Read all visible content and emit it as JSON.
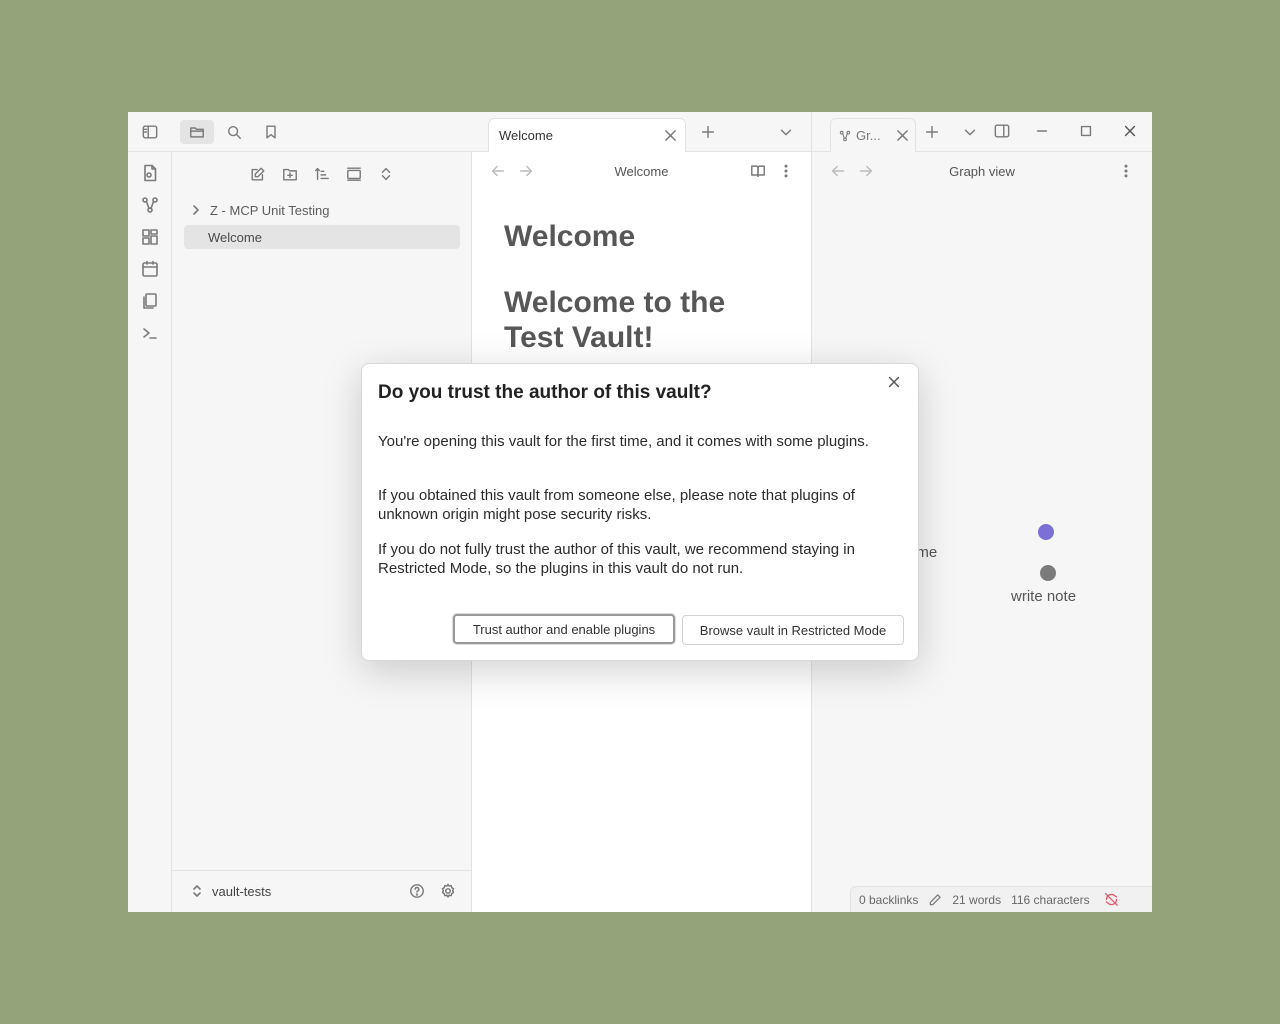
{
  "explorer": {
    "tree": [
      {
        "label": "Z - MCP Unit Testing",
        "type": "folder"
      },
      {
        "label": "Welcome",
        "type": "file",
        "selected": true
      }
    ],
    "vault_name": "vault-tests"
  },
  "editor": {
    "tab_label": "Welcome",
    "header_title": "Welcome",
    "h1": "Welcome",
    "h2_line1": "Welcome to the",
    "h2_line2": "Test Vault!"
  },
  "graph": {
    "tab_label": "Gr...",
    "header_title": "Graph view",
    "node_partial_label": "ome",
    "node_label": "write note"
  },
  "status": {
    "backlinks": "0 backlinks",
    "words": "21 words",
    "characters": "116 characters"
  },
  "modal": {
    "title": "Do you trust the author of this vault?",
    "p1": "You're opening this vault for the first time, and it comes with some plugins.",
    "p2": "If you obtained this vault from someone else, please note that plugins of unknown origin might pose security risks.",
    "p3": "If you do not fully trust the author of this vault, we recommend staying in Restricted Mode, so the plugins in this vault do not run.",
    "trust_button": "Trust author and enable plugins",
    "restricted_button": "Browse vault in Restricted Mode"
  },
  "colors": {
    "desktop": "#94a47a",
    "graph_node": "#7b7b7b",
    "graph_node_accent": "#7c6fd6",
    "sync_error": "#e05a6a"
  }
}
